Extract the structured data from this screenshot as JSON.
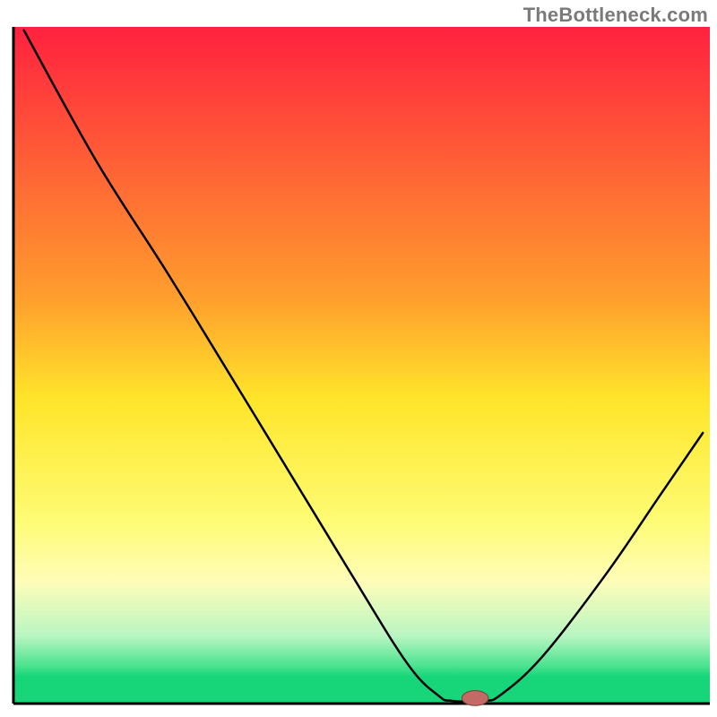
{
  "attribution": "TheBottleneck.com",
  "chart_data": {
    "type": "line",
    "title": "",
    "xlabel": "",
    "ylabel": "",
    "xlim": [
      0,
      100
    ],
    "ylim": [
      0,
      100
    ],
    "background_gradient": {
      "stops": [
        {
          "offset": 0.0,
          "color": "#ff213f"
        },
        {
          "offset": 0.4,
          "color": "#ff9e2d"
        },
        {
          "offset": 0.55,
          "color": "#ffe52a"
        },
        {
          "offset": 0.73,
          "color": "#fefc74"
        },
        {
          "offset": 0.82,
          "color": "#fffdb9"
        },
        {
          "offset": 0.9,
          "color": "#b9f6c2"
        },
        {
          "offset": 0.945,
          "color": "#49e28e"
        },
        {
          "offset": 0.96,
          "color": "#17d67a"
        },
        {
          "offset": 1.0,
          "color": "#17d67a"
        }
      ]
    },
    "series": [
      {
        "name": "bottleneck-curve",
        "color": "#000000",
        "width": 2.5,
        "points": [
          {
            "x": 1.5,
            "y": 99.5
          },
          {
            "x": 12.0,
            "y": 80.0
          },
          {
            "x": 22.5,
            "y": 63.0
          },
          {
            "x": 35.0,
            "y": 42.0
          },
          {
            "x": 48.0,
            "y": 20.0
          },
          {
            "x": 56.5,
            "y": 6.0
          },
          {
            "x": 61.0,
            "y": 1.2
          },
          {
            "x": 63.0,
            "y": 0.4
          },
          {
            "x": 67.5,
            "y": 0.4
          },
          {
            "x": 70.0,
            "y": 1.3
          },
          {
            "x": 76.0,
            "y": 7.0
          },
          {
            "x": 85.0,
            "y": 19.0
          },
          {
            "x": 93.0,
            "y": 31.0
          },
          {
            "x": 99.0,
            "y": 40.0
          }
        ]
      }
    ],
    "marker": {
      "name": "optimal-point",
      "x": 66.3,
      "y": 0.8,
      "rx": 1.9,
      "ry": 1.1,
      "fill": "#c36a67",
      "stroke": "#803c39"
    },
    "axes": {
      "color": "#000000",
      "width": 3
    }
  }
}
